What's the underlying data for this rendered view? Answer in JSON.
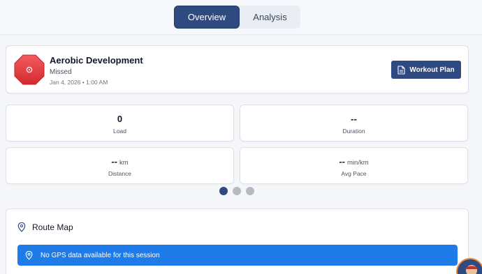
{
  "tabs": [
    {
      "label": "Overview",
      "active": true
    },
    {
      "label": "Analysis",
      "active": false
    }
  ],
  "session": {
    "title": "Aerobic Development",
    "status": "Missed",
    "date": "Jan 4, 2026 • 1:00 AM",
    "status_icon": "octagon-stop-icon",
    "status_color": "#e3363a"
  },
  "workout_plan_button": {
    "label": "Workout Plan",
    "icon": "document-icon"
  },
  "stats": {
    "load": {
      "value": "0",
      "label": "Load"
    },
    "duration": {
      "value": "--",
      "label": "Duration"
    },
    "distance": {
      "value": "--",
      "unit": "km",
      "label": "Distance"
    },
    "pace": {
      "value": "--",
      "unit": "min/km",
      "label": "Avg Pace"
    }
  },
  "carousel": {
    "pages": 3,
    "active_index": 0
  },
  "route_map": {
    "title": "Route Map",
    "icon": "map-pin-icon",
    "alert_text": "No GPS data available for this session",
    "alert_color": "#1f7be8"
  },
  "colors": {
    "accent": "#2f4a80"
  }
}
